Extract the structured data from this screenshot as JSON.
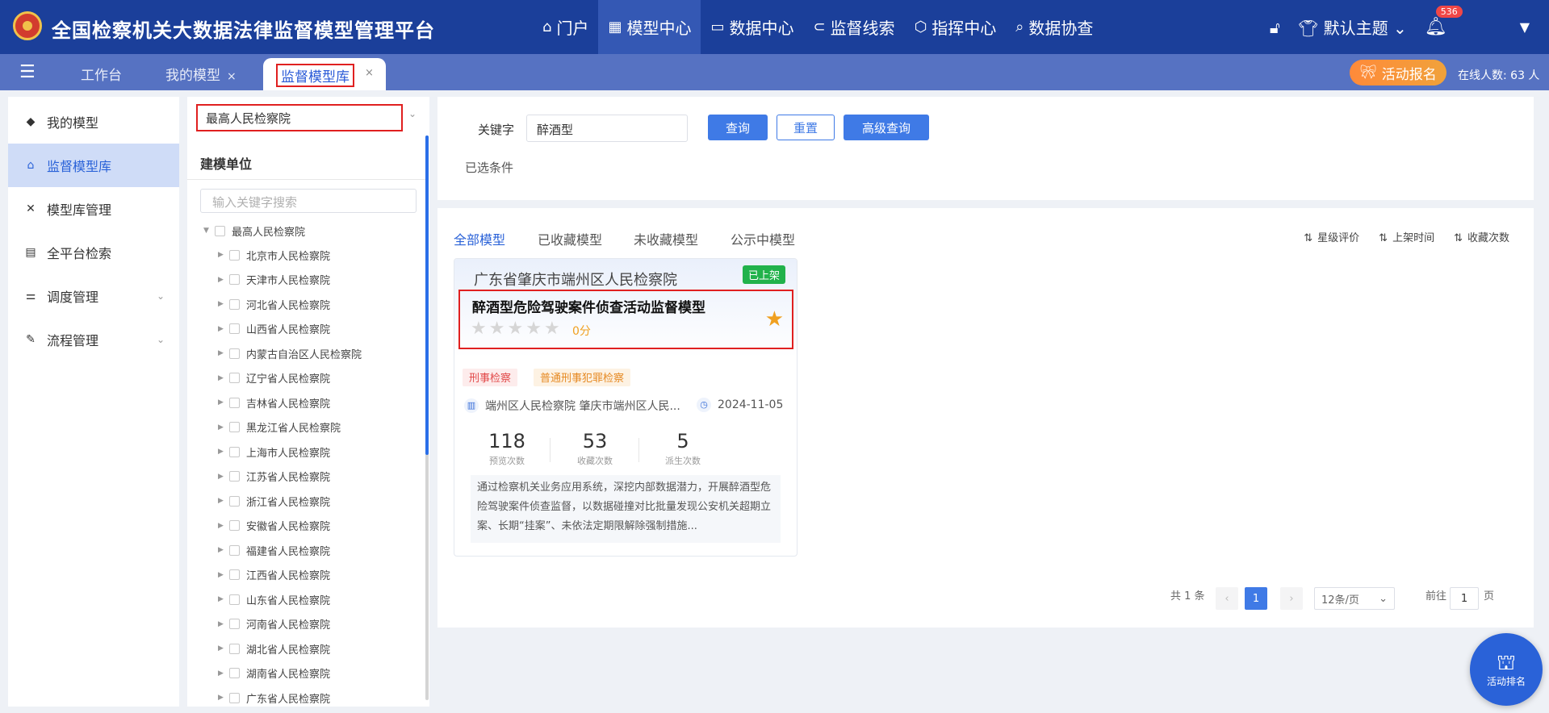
{
  "header": {
    "title": "全国检察机关大数据法律监督模型管理平台",
    "nav": [
      {
        "label": "门户",
        "icon": "home-icon"
      },
      {
        "label": "模型中心",
        "icon": "grid-icon",
        "active": true
      },
      {
        "label": "数据中心",
        "icon": "monitor-icon"
      },
      {
        "label": "监督线索",
        "icon": "link-icon"
      },
      {
        "label": "指挥中心",
        "icon": "cube-icon"
      },
      {
        "label": "数据协查",
        "icon": "search-doc-icon"
      }
    ],
    "theme_label": "默认主题",
    "notification_count": "536"
  },
  "tabbar": {
    "tabs": [
      {
        "label": "工作台"
      },
      {
        "label": "我的模型"
      },
      {
        "label": "监督模型库",
        "active": true
      }
    ],
    "event_button": "活动报名",
    "online": "在线人数: 63 人"
  },
  "sidebar": {
    "items": [
      {
        "label": "我的模型",
        "icon": "cube-icon"
      },
      {
        "label": "监督模型库",
        "icon": "bank-icon",
        "active": true
      },
      {
        "label": "模型库管理",
        "icon": "tools-icon"
      },
      {
        "label": "全平台检索",
        "icon": "document-icon"
      },
      {
        "label": "调度管理",
        "icon": "sliders-icon",
        "has_children": true
      },
      {
        "label": "流程管理",
        "icon": "edit-icon",
        "has_children": true
      }
    ]
  },
  "tree": {
    "select_value": "最高人民检察院",
    "header": "建模单位",
    "search_placeholder": "输入关键字搜索",
    "root": "最高人民检察院",
    "children": [
      "北京市人民检察院",
      "天津市人民检察院",
      "河北省人民检察院",
      "山西省人民检察院",
      "内蒙古自治区人民检察院",
      "辽宁省人民检察院",
      "吉林省人民检察院",
      "黑龙江省人民检察院",
      "上海市人民检察院",
      "江苏省人民检察院",
      "浙江省人民检察院",
      "安徽省人民检察院",
      "福建省人民检察院",
      "江西省人民检察院",
      "山东省人民检察院",
      "河南省人民检察院",
      "湖北省人民检察院",
      "湖南省人民检察院",
      "广东省人民检察院"
    ]
  },
  "search": {
    "keyword_label": "关键字",
    "keyword_value": "醉酒型",
    "query_button": "查询",
    "reset_button": "重置",
    "advanced_button": "高级查询",
    "selected_label": "已选条件"
  },
  "results": {
    "tabs": [
      "全部模型",
      "已收藏模型",
      "未收藏模型",
      "公示中模型"
    ],
    "active_tab": 0,
    "sorts": [
      "星级评价",
      "上架时间",
      "收藏次数"
    ],
    "card": {
      "org": "广东省肇庆市端州区人民检察院",
      "status": "已上架",
      "title": "醉酒型危险驾驶案件侦查活动监督模型",
      "rating": 0,
      "score": "0分",
      "tags": [
        "刑事检察",
        "普通刑事犯罪检察"
      ],
      "units": "端州区人民检察院 肇庆市端州区人民...",
      "date": "2024-11-05",
      "stats": [
        {
          "value": "118",
          "label": "预览次数"
        },
        {
          "value": "53",
          "label": "收藏次数"
        },
        {
          "value": "5",
          "label": "派生次数"
        }
      ],
      "description": "通过检察机关业务应用系统，深挖内部数据潜力，开展醉酒型危险驾驶案件侦查监督，以数据碰撞对比批量发现公安机关超期立案、长期“挂案”、未依法定期限解除强制措施..."
    },
    "pagination": {
      "total": "共 1 条",
      "current_page": "1",
      "page_size": "12条/页",
      "goto_prefix": "前往",
      "goto_value": "1",
      "goto_suffix": "页"
    }
  },
  "float_button": "活动排名",
  "colors": {
    "header_bg": "#1b3f9a",
    "tabbar_bg": "#5672c2",
    "accent": "#2a62d8",
    "highlight_border": "#e02020",
    "status_green": "#21b24b",
    "star_orange": "#f0a020"
  }
}
